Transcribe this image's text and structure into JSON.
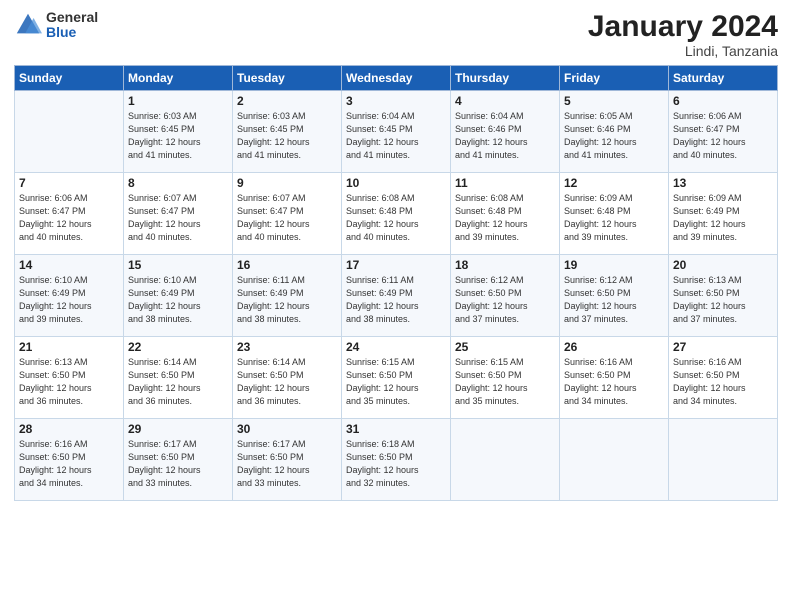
{
  "logo": {
    "general": "General",
    "blue": "Blue"
  },
  "title": "January 2024",
  "location": "Lindi, Tanzania",
  "days_of_week": [
    "Sunday",
    "Monday",
    "Tuesday",
    "Wednesday",
    "Thursday",
    "Friday",
    "Saturday"
  ],
  "weeks": [
    [
      {
        "day": "",
        "sunrise": "",
        "sunset": "",
        "daylight": ""
      },
      {
        "day": "1",
        "sunrise": "Sunrise: 6:03 AM",
        "sunset": "Sunset: 6:45 PM",
        "daylight": "Daylight: 12 hours and 41 minutes."
      },
      {
        "day": "2",
        "sunrise": "Sunrise: 6:03 AM",
        "sunset": "Sunset: 6:45 PM",
        "daylight": "Daylight: 12 hours and 41 minutes."
      },
      {
        "day": "3",
        "sunrise": "Sunrise: 6:04 AM",
        "sunset": "Sunset: 6:45 PM",
        "daylight": "Daylight: 12 hours and 41 minutes."
      },
      {
        "day": "4",
        "sunrise": "Sunrise: 6:04 AM",
        "sunset": "Sunset: 6:46 PM",
        "daylight": "Daylight: 12 hours and 41 minutes."
      },
      {
        "day": "5",
        "sunrise": "Sunrise: 6:05 AM",
        "sunset": "Sunset: 6:46 PM",
        "daylight": "Daylight: 12 hours and 41 minutes."
      },
      {
        "day": "6",
        "sunrise": "Sunrise: 6:06 AM",
        "sunset": "Sunset: 6:47 PM",
        "daylight": "Daylight: 12 hours and 40 minutes."
      }
    ],
    [
      {
        "day": "7",
        "sunrise": "Sunrise: 6:06 AM",
        "sunset": "Sunset: 6:47 PM",
        "daylight": "Daylight: 12 hours and 40 minutes."
      },
      {
        "day": "8",
        "sunrise": "Sunrise: 6:07 AM",
        "sunset": "Sunset: 6:47 PM",
        "daylight": "Daylight: 12 hours and 40 minutes."
      },
      {
        "day": "9",
        "sunrise": "Sunrise: 6:07 AM",
        "sunset": "Sunset: 6:47 PM",
        "daylight": "Daylight: 12 hours and 40 minutes."
      },
      {
        "day": "10",
        "sunrise": "Sunrise: 6:08 AM",
        "sunset": "Sunset: 6:48 PM",
        "daylight": "Daylight: 12 hours and 40 minutes."
      },
      {
        "day": "11",
        "sunrise": "Sunrise: 6:08 AM",
        "sunset": "Sunset: 6:48 PM",
        "daylight": "Daylight: 12 hours and 39 minutes."
      },
      {
        "day": "12",
        "sunrise": "Sunrise: 6:09 AM",
        "sunset": "Sunset: 6:48 PM",
        "daylight": "Daylight: 12 hours and 39 minutes."
      },
      {
        "day": "13",
        "sunrise": "Sunrise: 6:09 AM",
        "sunset": "Sunset: 6:49 PM",
        "daylight": "Daylight: 12 hours and 39 minutes."
      }
    ],
    [
      {
        "day": "14",
        "sunrise": "Sunrise: 6:10 AM",
        "sunset": "Sunset: 6:49 PM",
        "daylight": "Daylight: 12 hours and 39 minutes."
      },
      {
        "day": "15",
        "sunrise": "Sunrise: 6:10 AM",
        "sunset": "Sunset: 6:49 PM",
        "daylight": "Daylight: 12 hours and 38 minutes."
      },
      {
        "day": "16",
        "sunrise": "Sunrise: 6:11 AM",
        "sunset": "Sunset: 6:49 PM",
        "daylight": "Daylight: 12 hours and 38 minutes."
      },
      {
        "day": "17",
        "sunrise": "Sunrise: 6:11 AM",
        "sunset": "Sunset: 6:49 PM",
        "daylight": "Daylight: 12 hours and 38 minutes."
      },
      {
        "day": "18",
        "sunrise": "Sunrise: 6:12 AM",
        "sunset": "Sunset: 6:50 PM",
        "daylight": "Daylight: 12 hours and 37 minutes."
      },
      {
        "day": "19",
        "sunrise": "Sunrise: 6:12 AM",
        "sunset": "Sunset: 6:50 PM",
        "daylight": "Daylight: 12 hours and 37 minutes."
      },
      {
        "day": "20",
        "sunrise": "Sunrise: 6:13 AM",
        "sunset": "Sunset: 6:50 PM",
        "daylight": "Daylight: 12 hours and 37 minutes."
      }
    ],
    [
      {
        "day": "21",
        "sunrise": "Sunrise: 6:13 AM",
        "sunset": "Sunset: 6:50 PM",
        "daylight": "Daylight: 12 hours and 36 minutes."
      },
      {
        "day": "22",
        "sunrise": "Sunrise: 6:14 AM",
        "sunset": "Sunset: 6:50 PM",
        "daylight": "Daylight: 12 hours and 36 minutes."
      },
      {
        "day": "23",
        "sunrise": "Sunrise: 6:14 AM",
        "sunset": "Sunset: 6:50 PM",
        "daylight": "Daylight: 12 hours and 36 minutes."
      },
      {
        "day": "24",
        "sunrise": "Sunrise: 6:15 AM",
        "sunset": "Sunset: 6:50 PM",
        "daylight": "Daylight: 12 hours and 35 minutes."
      },
      {
        "day": "25",
        "sunrise": "Sunrise: 6:15 AM",
        "sunset": "Sunset: 6:50 PM",
        "daylight": "Daylight: 12 hours and 35 minutes."
      },
      {
        "day": "26",
        "sunrise": "Sunrise: 6:16 AM",
        "sunset": "Sunset: 6:50 PM",
        "daylight": "Daylight: 12 hours and 34 minutes."
      },
      {
        "day": "27",
        "sunrise": "Sunrise: 6:16 AM",
        "sunset": "Sunset: 6:50 PM",
        "daylight": "Daylight: 12 hours and 34 minutes."
      }
    ],
    [
      {
        "day": "28",
        "sunrise": "Sunrise: 6:16 AM",
        "sunset": "Sunset: 6:50 PM",
        "daylight": "Daylight: 12 hours and 34 minutes."
      },
      {
        "day": "29",
        "sunrise": "Sunrise: 6:17 AM",
        "sunset": "Sunset: 6:50 PM",
        "daylight": "Daylight: 12 hours and 33 minutes."
      },
      {
        "day": "30",
        "sunrise": "Sunrise: 6:17 AM",
        "sunset": "Sunset: 6:50 PM",
        "daylight": "Daylight: 12 hours and 33 minutes."
      },
      {
        "day": "31",
        "sunrise": "Sunrise: 6:18 AM",
        "sunset": "Sunset: 6:50 PM",
        "daylight": "Daylight: 12 hours and 32 minutes."
      },
      {
        "day": "",
        "sunrise": "",
        "sunset": "",
        "daylight": ""
      },
      {
        "day": "",
        "sunrise": "",
        "sunset": "",
        "daylight": ""
      },
      {
        "day": "",
        "sunrise": "",
        "sunset": "",
        "daylight": ""
      }
    ]
  ]
}
